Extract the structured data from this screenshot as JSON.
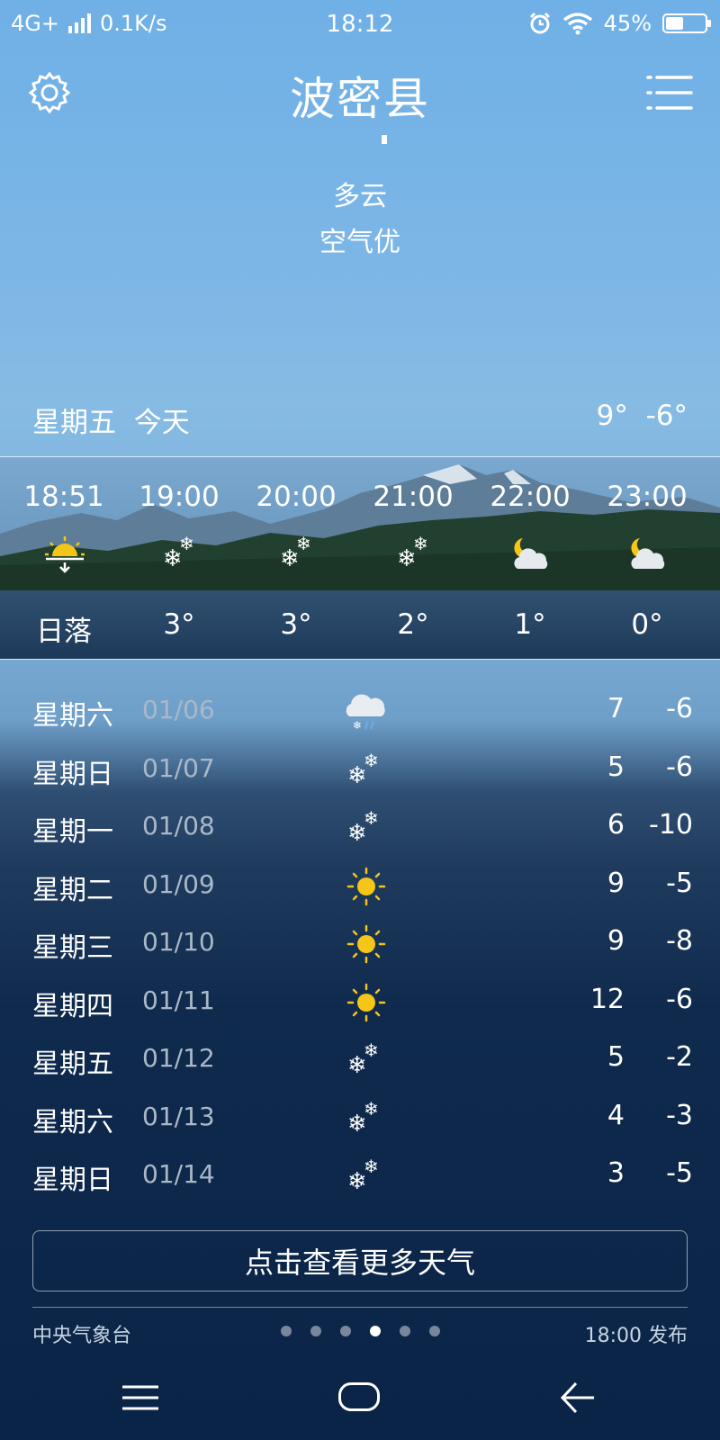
{
  "status_bar": {
    "network": "4G+",
    "speed": "0.1K/s",
    "time": "18:12",
    "battery_text": "45%",
    "battery_level": 0.45,
    "icons": [
      "signal-icon",
      "alarm-icon",
      "wifi-icon",
      "battery-icon"
    ]
  },
  "header": {
    "city": "波密县",
    "condition": "多云",
    "air_quality": "空气优"
  },
  "today": {
    "weekday": "星期五",
    "label": "今天",
    "high": "9°",
    "low": "-6°"
  },
  "hourly": [
    {
      "time": "18:51",
      "icon": "sunset-icon",
      "value": "日落"
    },
    {
      "time": "19:00",
      "icon": "snow-icon",
      "value": "3°"
    },
    {
      "time": "20:00",
      "icon": "snow-icon",
      "value": "3°"
    },
    {
      "time": "21:00",
      "icon": "snow-icon",
      "value": "2°"
    },
    {
      "time": "22:00",
      "icon": "moon-cloud-icon",
      "value": "1°"
    },
    {
      "time": "23:00",
      "icon": "moon-cloud-icon",
      "value": "0°"
    }
  ],
  "daily": [
    {
      "weekday": "星期六",
      "date": "01/06",
      "icon": "sleet-icon",
      "high": "7",
      "low": "-6"
    },
    {
      "weekday": "星期日",
      "date": "01/07",
      "icon": "snow-icon",
      "high": "5",
      "low": "-6"
    },
    {
      "weekday": "星期一",
      "date": "01/08",
      "icon": "snow-icon",
      "high": "6",
      "low": "-10"
    },
    {
      "weekday": "星期二",
      "date": "01/09",
      "icon": "sun-icon",
      "high": "9",
      "low": "-5"
    },
    {
      "weekday": "星期三",
      "date": "01/10",
      "icon": "sun-icon",
      "high": "9",
      "low": "-8"
    },
    {
      "weekday": "星期四",
      "date": "01/11",
      "icon": "sun-icon",
      "high": "12",
      "low": "-6"
    },
    {
      "weekday": "星期五",
      "date": "01/12",
      "icon": "snow-icon",
      "high": "5",
      "low": "-2"
    },
    {
      "weekday": "星期六",
      "date": "01/13",
      "icon": "snow-icon",
      "high": "4",
      "low": "-3"
    },
    {
      "weekday": "星期日",
      "date": "01/14",
      "icon": "snow-icon",
      "high": "3",
      "low": "-5"
    }
  ],
  "more_button": "点击查看更多天气",
  "footer": {
    "source": "中央气象台",
    "published": "18:00 发布",
    "pages": 6,
    "active_page": 4
  },
  "colors": {
    "sky_top": "#6fb0e6",
    "bottom": "#0a2447",
    "sun": "#f5c518"
  }
}
